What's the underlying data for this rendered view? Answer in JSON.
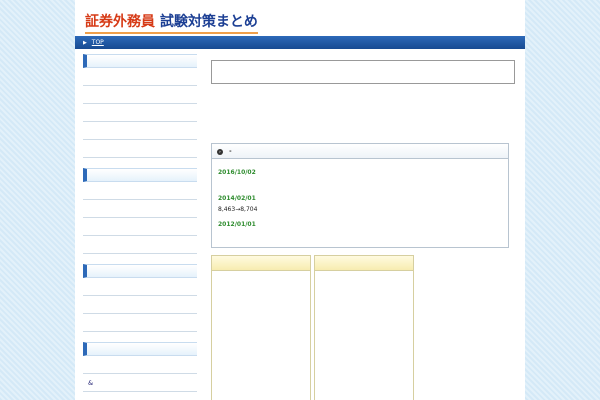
{
  "header": {
    "title_accent": "証券外務員",
    "title_rest": " 試験対策まとめ",
    "tagline": ""
  },
  "nav": {
    "crumb": "",
    "top_label": "TOP"
  },
  "sidebar": {
    "sections": [
      {
        "heading": "",
        "items": [
          "",
          "",
          "",
          "",
          ""
        ]
      },
      {
        "heading": "",
        "items": [
          "",
          "",
          "",
          ""
        ]
      },
      {
        "heading": "",
        "items": [
          "",
          "",
          ""
        ]
      },
      {
        "heading": "",
        "items": [
          "",
          ""
        ]
      }
    ],
    "item_suffixes": {
      "s2_i2": "",
      "s3_i1": "&"
    }
  },
  "main": {
    "page_title": "",
    "intro_lead": "",
    "intro_line1": "",
    "intro_line2": "",
    "news": {
      "heading_left": "",
      "heading_sep": "-",
      "heading_right": "",
      "items": [
        {
          "date": "2016/10/02",
          "tag": "",
          "text_before": "",
          "link": "",
          "text_after": ""
        },
        {
          "date": "2014/02/01",
          "tag": "",
          "text_before": "",
          "num_old": "8,463",
          "arrow": "→",
          "num_new": "8,704",
          "text_after": ""
        },
        {
          "date": "2012/01/01",
          "tag": "",
          "text_before": "",
          "text_after": ""
        }
      ]
    }
  },
  "cards": [
    {
      "heading": "",
      "entries": [
        {
          "link": "",
          "sub": ""
        },
        {
          "link": "",
          "sub": ""
        },
        {
          "link": "",
          "sub": ""
        },
        {
          "link": "",
          "sub": ""
        },
        {
          "link": "",
          "sub": ""
        }
      ]
    },
    {
      "heading": "",
      "entries": [
        {
          "link": "",
          "sub": ""
        },
        {
          "link": "",
          "sub": ""
        },
        {
          "link": "",
          "sub": ""
        },
        {
          "link": "",
          "sub": ""
        }
      ]
    }
  ],
  "colors": {
    "brand_blue": "#1c3f94",
    "accent_red": "#d63a16",
    "nav_blue": "#2d69b8",
    "news_green": "#2e8c2e",
    "highlight": "#fff6a8"
  }
}
